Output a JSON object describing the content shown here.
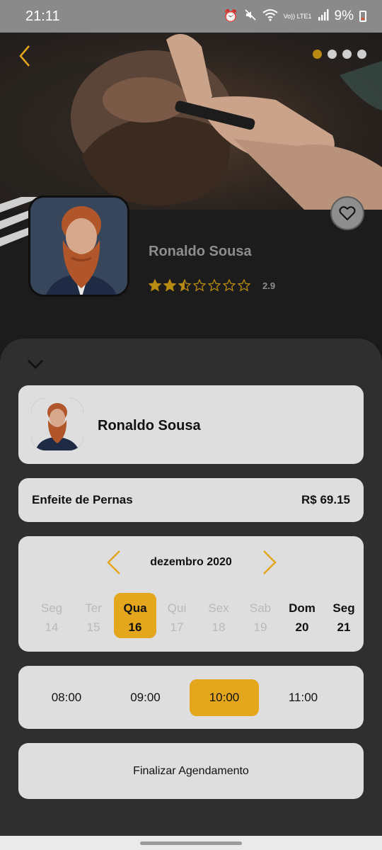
{
  "status_bar": {
    "time": "21:11",
    "network_label": "Vo)) LTE1",
    "battery": "9%",
    "icons": [
      "alarm-icon",
      "mute-icon",
      "wifi-icon",
      "signal-icon",
      "battery-icon"
    ]
  },
  "hero": {
    "carousel": {
      "count": 4,
      "active_index": 0
    }
  },
  "profile": {
    "name": "Ronaldo Sousa",
    "rating": 2.9,
    "rating_label": "2.9",
    "stars_total": 7
  },
  "booking": {
    "barber_name": "Ronaldo Sousa",
    "service": {
      "name": "Enfeite de Pernas",
      "price": "R$ 69.15"
    },
    "calendar": {
      "month": "dezembro 2020",
      "days": [
        {
          "name": "Seg",
          "num": "14",
          "state": "past"
        },
        {
          "name": "Ter",
          "num": "15",
          "state": "past"
        },
        {
          "name": "Qua",
          "num": "16",
          "state": "selected"
        },
        {
          "name": "Qui",
          "num": "17",
          "state": "past"
        },
        {
          "name": "Sex",
          "num": "18",
          "state": "past"
        },
        {
          "name": "Sab",
          "num": "19",
          "state": "past"
        },
        {
          "name": "Dom",
          "num": "20",
          "state": "future"
        },
        {
          "name": "Seg",
          "num": "21",
          "state": "future"
        }
      ]
    },
    "times": [
      {
        "label": "08:00",
        "selected": false
      },
      {
        "label": "09:00",
        "selected": false
      },
      {
        "label": "10:00",
        "selected": true
      },
      {
        "label": "11:00",
        "selected": false
      }
    ],
    "submit_label": "Finalizar Agendamento"
  },
  "colors": {
    "accent": "#e3a61c",
    "star": "#b98a12",
    "sheet": "#2f2f2f",
    "card": "#dedede"
  }
}
